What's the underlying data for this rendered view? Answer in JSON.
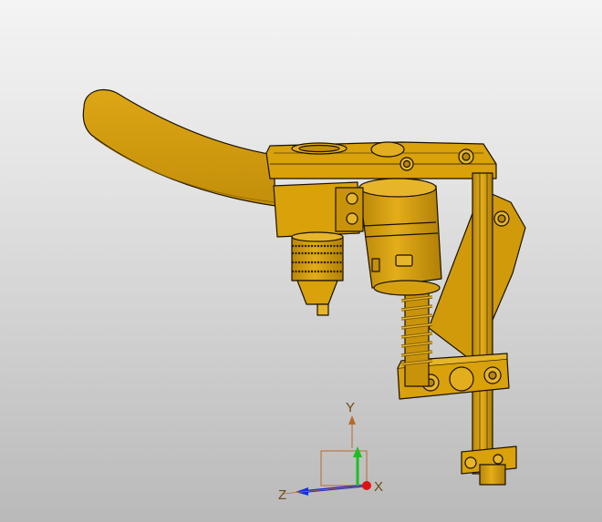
{
  "viewport": {
    "background_top": "#f4f4f4",
    "background_bottom": "#b9b9b9"
  },
  "model": {
    "body_color": "#d9a10a",
    "edge_color": "#1a1200",
    "shade_color": "#b88608",
    "highlight_color": "#e6b52a"
  },
  "triad": {
    "x_label": "X",
    "y_label": "Y",
    "z_label": "Z",
    "x_color": "#e01010",
    "y_color": "#1fbf1f",
    "z_color": "#1a2fd8",
    "label_color": "#6b4a14",
    "box_color": "#b86a2a"
  }
}
